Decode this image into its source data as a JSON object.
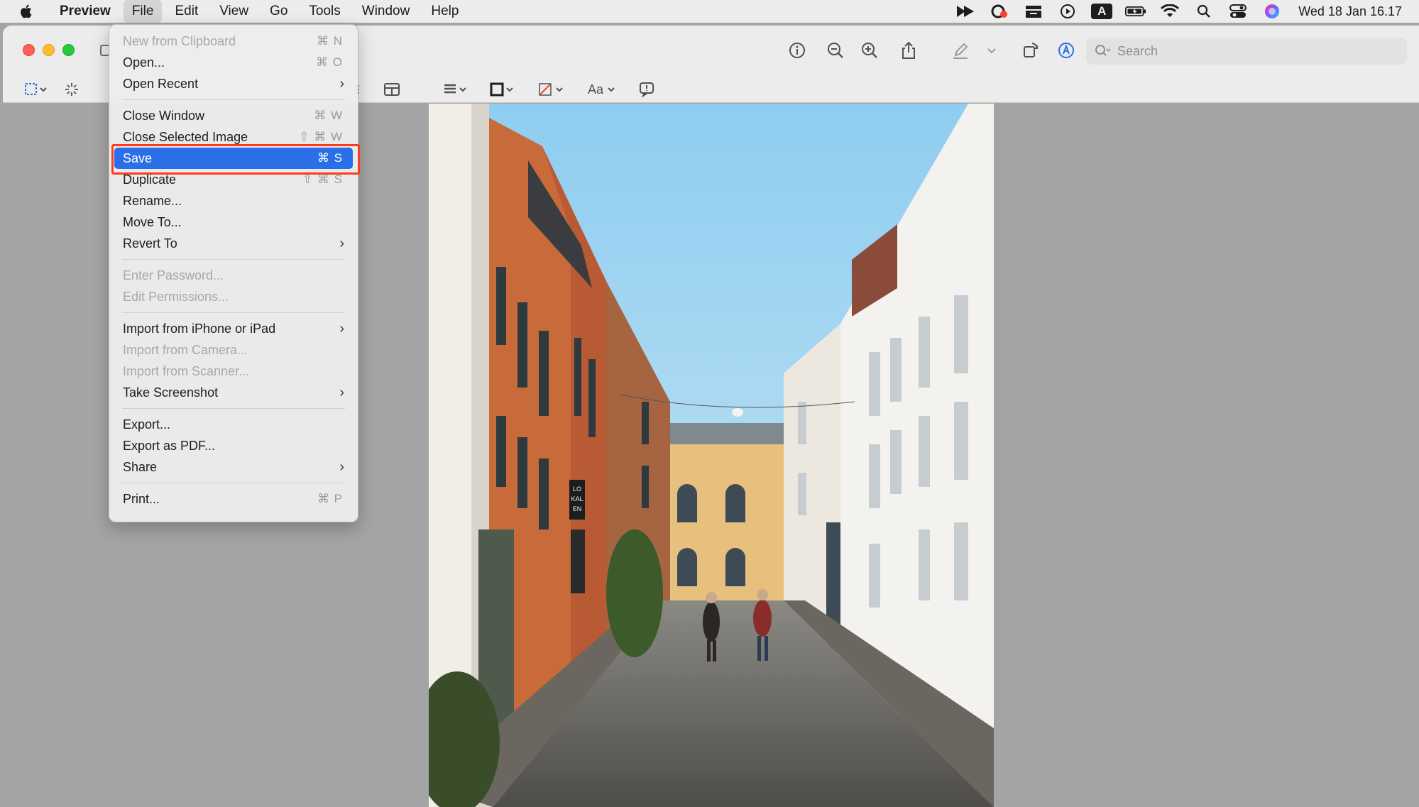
{
  "menubar": {
    "app_name": "Preview",
    "menus": [
      "File",
      "Edit",
      "View",
      "Go",
      "Tools",
      "Window",
      "Help"
    ],
    "input_source": "A",
    "clock": "Wed 18 Jan 16.17"
  },
  "toolbar": {
    "search_placeholder": "Search",
    "text_style_label": "Aa"
  },
  "file_menu": {
    "items": [
      {
        "label": "New from Clipboard",
        "shortcut": "⌘ N",
        "disabled": true
      },
      {
        "label": "Open...",
        "shortcut": "⌘ O"
      },
      {
        "label": "Open Recent",
        "submenu": true
      },
      {
        "label": "Close Window",
        "shortcut": "⌘ W"
      },
      {
        "label": "Close Selected Image",
        "shortcut": "⇧ ⌘ W"
      },
      {
        "label": "Save",
        "shortcut": "⌘ S",
        "highlighted": true
      },
      {
        "label": "Duplicate",
        "shortcut": "⇧ ⌘ S"
      },
      {
        "label": "Rename..."
      },
      {
        "label": "Move To..."
      },
      {
        "label": "Revert To",
        "submenu": true
      },
      {
        "label": "Enter Password...",
        "disabled": true
      },
      {
        "label": "Edit Permissions...",
        "disabled": true
      },
      {
        "label": "Import from iPhone or iPad",
        "submenu": true
      },
      {
        "label": "Import from Camera...",
        "disabled": true
      },
      {
        "label": "Import from Scanner...",
        "disabled": true
      },
      {
        "label": "Take Screenshot",
        "submenu": true
      },
      {
        "label": "Export..."
      },
      {
        "label": "Export as PDF..."
      },
      {
        "label": "Share",
        "submenu": true
      },
      {
        "label": "Print...",
        "shortcut": "⌘ P"
      }
    ]
  },
  "photo": {
    "sign_text": "LO KAL EN"
  },
  "colors": {
    "highlight": "#2a6fe8",
    "focus_ring": "#ff3b1f"
  }
}
